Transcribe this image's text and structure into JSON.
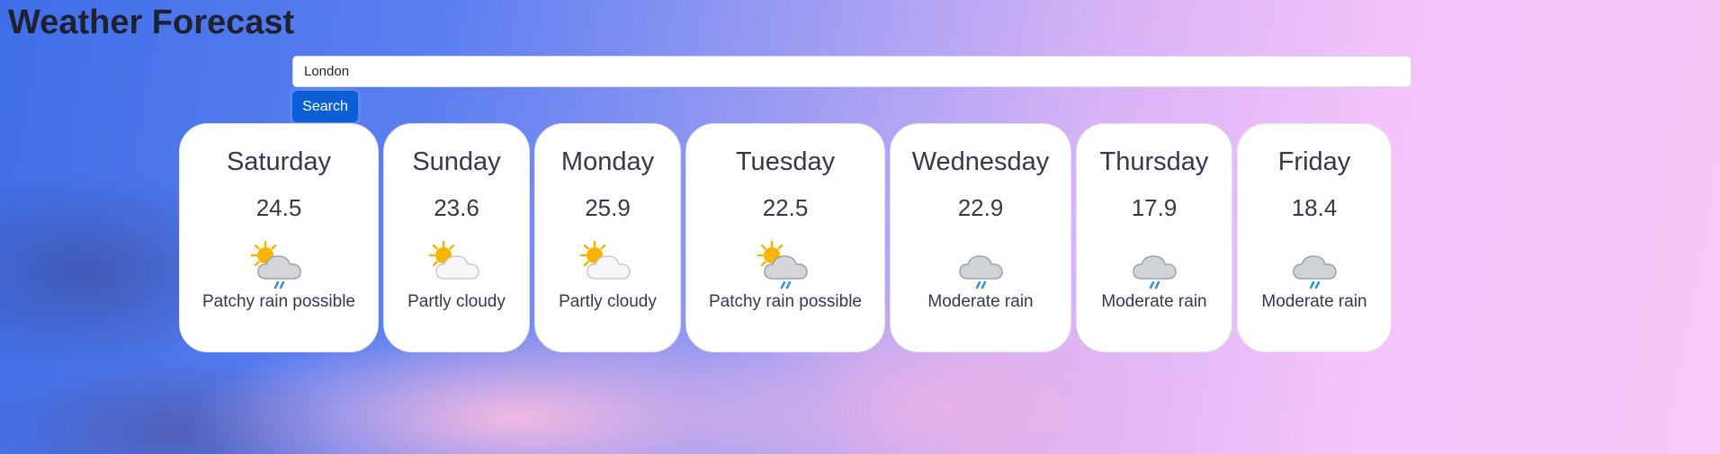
{
  "app": {
    "title": "Weather Forecast"
  },
  "search": {
    "value": "London",
    "button_label": "Search"
  },
  "forecast": [
    {
      "day": "Saturday",
      "temp": "24.5",
      "condition": "Patchy rain possible",
      "icon": "sun-cloud-rain-icon"
    },
    {
      "day": "Sunday",
      "temp": "23.6",
      "condition": "Partly cloudy",
      "icon": "partly-cloudy-icon"
    },
    {
      "day": "Monday",
      "temp": "25.9",
      "condition": "Partly cloudy",
      "icon": "partly-cloudy-icon"
    },
    {
      "day": "Tuesday",
      "temp": "22.5",
      "condition": "Patchy rain possible",
      "icon": "sun-cloud-rain-icon"
    },
    {
      "day": "Wednesday",
      "temp": "22.9",
      "condition": "Moderate rain",
      "icon": "rain-cloud-icon"
    },
    {
      "day": "Thursday",
      "temp": "17.9",
      "condition": "Moderate rain",
      "icon": "rain-cloud-icon"
    },
    {
      "day": "Friday",
      "temp": "18.4",
      "condition": "Moderate rain",
      "icon": "rain-cloud-icon"
    }
  ],
  "colors": {
    "accent": "#0d5fd8",
    "sun": "#f7b500",
    "cloud": "#cfd2d6",
    "rain": "#2b8fe0"
  }
}
